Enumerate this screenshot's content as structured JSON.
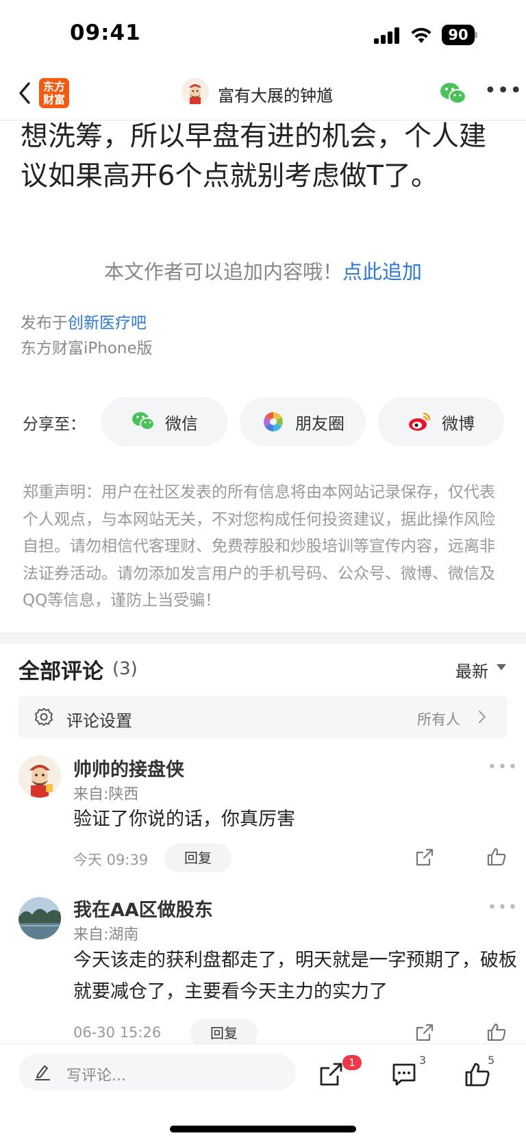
{
  "status": {
    "time": "09:41",
    "battery": "90"
  },
  "nav": {
    "logo_text_1": "东方",
    "logo_text_2": "财富",
    "author": "富有大展的钟馗"
  },
  "article": {
    "text": "想洗筹，所以早盘有进的机会，个人建议如果高开6个点就别考虑做T了。"
  },
  "append": {
    "prompt": "本文作者可以追加内容哦！",
    "link": "点此追加"
  },
  "published": {
    "prefix": "发布于",
    "forum": "创新医疗吧",
    "client": "东方财富iPhone版"
  },
  "share": {
    "label": "分享至：",
    "buttons": [
      {
        "label": "微信",
        "icon": "wechat-icon"
      },
      {
        "label": "朋友圈",
        "icon": "moments-icon"
      },
      {
        "label": "微博",
        "icon": "weibo-icon"
      }
    ]
  },
  "disclaimer": "郑重声明：用户在社区发表的所有信息将由本网站记录保存，仅代表个人观点，与本网站无关，不对您构成任何投资建议，据此操作风险自担。请勿相信代客理财、免费荐股和炒股培训等宣传内容，远离非法证券活动。请勿添加发言用户的手机号码、公众号、微博、微信及QQ等信息，谨防上当受骗！",
  "comments": {
    "title": "全部评论",
    "count": "(3)",
    "sort": "最新",
    "settings_label": "评论设置",
    "settings_value": "所有人",
    "items": [
      {
        "name": "帅帅的接盘侠",
        "location": "来自:陕西",
        "text": "验证了你说的话，你真厉害",
        "time": "今天 09:39",
        "reply": "回复"
      },
      {
        "name": "我在AA区做股东",
        "location": "来自:湖南",
        "text": "今天该走的获利盘都走了，明天就是一字预期了，破板就要减仓了，主要看今天主力的实力了",
        "time": "06-30 15:26",
        "reply": "回复"
      }
    ]
  },
  "bottom_bar": {
    "compose_placeholder": "写评论...",
    "share_badge": "1",
    "comment_count": "3",
    "like_count": "5"
  },
  "colors": {
    "brand": "#f35a12",
    "link": "#2d7ad6",
    "badge": "#f0374a"
  }
}
